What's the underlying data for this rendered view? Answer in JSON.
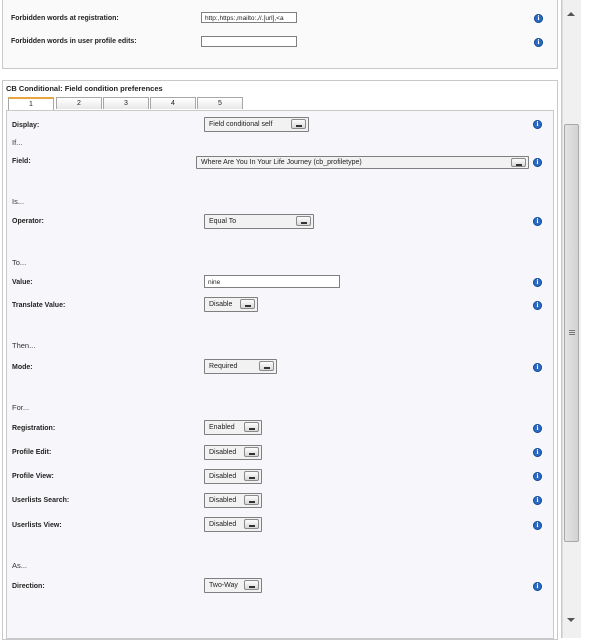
{
  "top": {
    "forbidden_registration_label": "Forbidden words at registration:",
    "forbidden_registration_value": "http:,https:,mailto:,//.[url],<a",
    "forbidden_profile_label": "Forbidden words in user profile edits:",
    "forbidden_profile_value": ""
  },
  "cb": {
    "title": "CB Conditional: Field condition preferences",
    "tabs": [
      "1",
      "2",
      "3",
      "4",
      "5"
    ],
    "display_label": "Display:",
    "display_value": "Field conditional self",
    "if_heading": "If...",
    "field_label": "Field:",
    "field_value": "Where Are You In Your Life Journey (cb_profiletype)",
    "is_heading": "Is...",
    "operator_label": "Operator:",
    "operator_value": "Equal To",
    "to_heading": "To...",
    "value_label": "Value:",
    "value_value": "nine",
    "translate_label": "Translate Value:",
    "translate_value": "Disable",
    "then_heading": "Then...",
    "mode_label": "Mode:",
    "mode_value": "Required",
    "for_heading": "For...",
    "registration_label": "Registration:",
    "registration_value": "Enabled",
    "profile_edit_label": "Profile Edit:",
    "profile_edit_value": "Disabled",
    "profile_view_label": "Profile View:",
    "profile_view_value": "Disabled",
    "userlists_search_label": "Userlists Search:",
    "userlists_search_value": "Disabled",
    "userlists_view_label": "Userlists View:",
    "userlists_view_value": "Disabled",
    "as_heading": "As...",
    "direction_label": "Direction:",
    "direction_value": "Two-Way"
  },
  "icons": {
    "info": "info-icon",
    "scroll_up": "scroll-up-arrow-icon",
    "scroll_down": "scroll-down-arrow-icon"
  },
  "colors": {
    "info_blue": "#2c6bc4",
    "active_tab_accent": "#e9a640"
  }
}
